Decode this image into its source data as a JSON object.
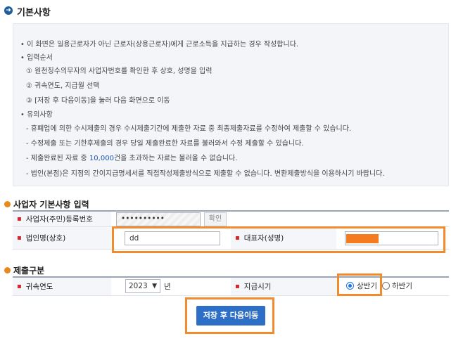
{
  "section1": {
    "icon": "arrow-right-circle-icon",
    "title": "기본사항",
    "lines": [
      "• 이 화면은 일용근로자가 아닌 근로자(상용근로자)에게 근로소득을 지급하는 경우 작성합니다.",
      "• 입력순서",
      "① 원천징수의무자의 사업자번호를 확인한 후 상호, 성명을 입력",
      "② 귀속연도, 지급월 선택",
      "③ [저장 후 다음이동]을 눌러 다음 화면으로 이동",
      "• 유의사항",
      "- 휴폐업에 의한 수시제출의 경우 수시제출기간에 제출한 자료 중 최종제출자료를 수정하여 제출할 수 있습니다.",
      "- 수정제출 또는 기한후제출의 경우 당일 제출완료한 자료를 불러와서 수정 제출할 수 있습니다.",
      "- 법인(본점)은 지점의 간이지급명세서를 직접작성제출방식으로 제출할 수 없습니다. 변환제출방식을 이용하시기 바랍니다."
    ],
    "note3_prefix": "- 제출완료된 자료 중 ",
    "note3_highlight": "10,000",
    "note3_suffix": "건을 초과하는 자료는 불러올 수 없습니다."
  },
  "section2": {
    "title": "사업자 기본사항 입력",
    "bizno_label": "사업자(주민)등록번호",
    "bizno_value": "••••••••••",
    "confirm_label": "확인",
    "corp_label": "법인명(상호)",
    "corp_value": "dd",
    "rep_label": "대표자(성명)",
    "rep_value": ""
  },
  "section3": {
    "title": "제출구분",
    "year_label": "귀속연도",
    "year_value": "2023",
    "year_unit": "년",
    "period_label": "지급시기",
    "option1": "상반기",
    "option2": "하반기"
  },
  "save_label": "저장 후 다음이동",
  "colors": {
    "highlight": "#f28a2e",
    "accent": "#2d6fc7",
    "required": "#d4282f",
    "redact": "#f47b20"
  }
}
